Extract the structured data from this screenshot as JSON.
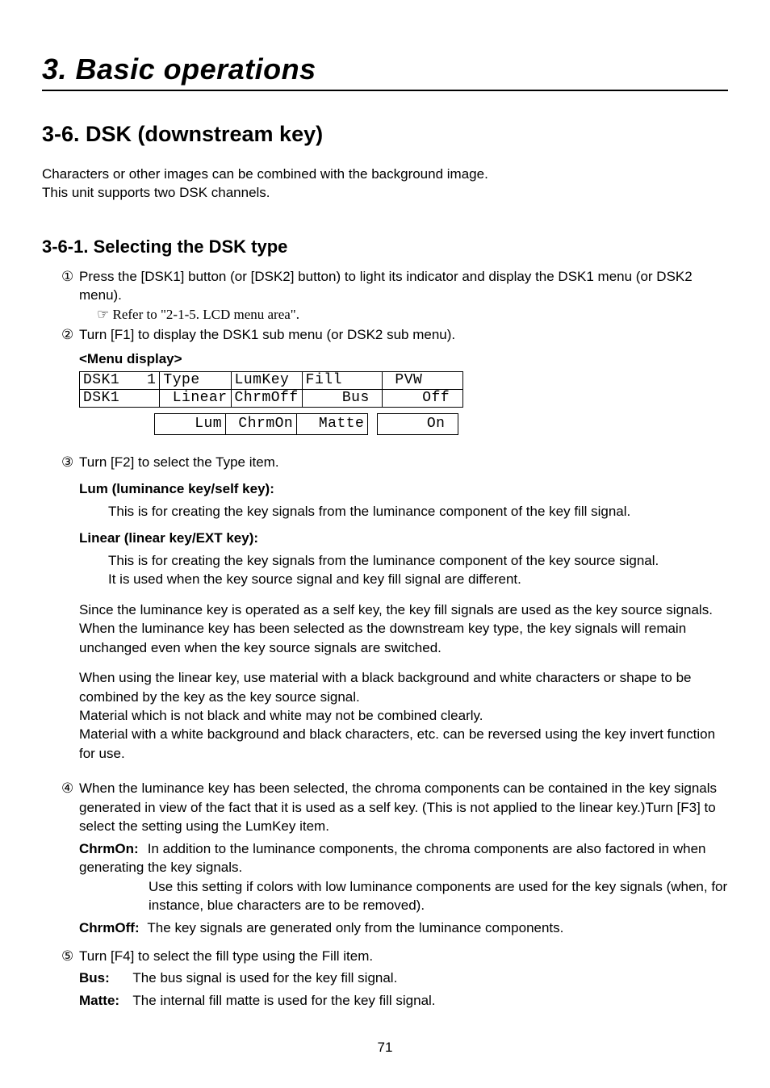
{
  "chapter": "3. Basic operations",
  "h2": "3-6. DSK (downstream key)",
  "intro1": "Characters or other images can be combined with the background image.",
  "intro2": "This unit supports two DSK channels.",
  "h3": "3-6-1. Selecting the DSK type",
  "circled": {
    "1": "①",
    "2": "②",
    "3": "③",
    "4": "④",
    "5": "⑤"
  },
  "step1": {
    "text": "Press the [DSK1] button (or [DSK2] button) to light its indicator and display the DSK1 menu (or DSK2 menu).",
    "ref_glyph": "☞",
    "ref": " Refer to \"2-1-5. LCD menu area\"."
  },
  "step2": {
    "text": "Turn [F1] to display the DSK1 sub menu (or DSK2 sub menu).",
    "menu_label": "<Menu display>"
  },
  "lcd": {
    "r1c1": "DSK1   1",
    "r1c2": "Type   ",
    "r1c3": "LumKey ",
    "r1c4": "Fill    ",
    "r1c5": " PVW    ",
    "r2c1": "DSK1    ",
    "r2c2": " Linear",
    "r2c3": "ChrmOff",
    "r2c4": "    Bus ",
    "r2c5": "    Off ",
    "optc2": "    Lum",
    "optc3": " ChrmOn",
    "optc4": "  Matte",
    "optc5": "     On "
  },
  "step3": {
    "text": "Turn [F2] to select the Type item.",
    "lum_h": "Lum (luminance key/self key):",
    "lum_b": "This is for creating the key signals from the luminance component of the key fill signal.",
    "lin_h": "Linear (linear key/EXT key):",
    "lin_b1": "This is for creating the key signals from the luminance component of the key source signal.",
    "lin_b2": "It is used when the key source signal and key fill signal are different.",
    "p1": "Since the luminance key is operated as a self key, the key fill signals are used as the key source signals. When the luminance key has been selected as the downstream key type, the key signals will remain unchanged even when the key source signals are switched.",
    "p2a": "When using the linear key, use material with a black background and white characters or shape to be combined by the key as the key source signal.",
    "p2b": "Material which is not black and white may not be combined clearly.",
    "p2c": "Material with a white background and black characters, etc. can be reversed using the key invert function for use."
  },
  "step4": {
    "text": "When the luminance key has been selected, the chroma components can be contained in the key signals generated in view of the fact that it is used as a self key. (This is not applied to the linear key.)Turn [F3] to select the setting using the LumKey item.",
    "on_k": "ChrmOn:",
    "on_v1": "In addition to the luminance components, the chroma components are also factored in when generating the key signals.",
    "on_v2": "Use this setting if colors with low luminance components are used for the key signals (when, for instance, blue characters are to be removed).",
    "off_k": "ChrmOff:",
    "off_v": "The key signals are generated only from the luminance components."
  },
  "step5": {
    "text": "Turn [F4] to select the fill type using the Fill item.",
    "bus_k": "Bus:",
    "bus_v": "The bus signal is used for the key fill signal.",
    "matte_k": "Matte:",
    "matte_v": "The internal fill matte is used for the key fill signal."
  },
  "pagenum": "71"
}
